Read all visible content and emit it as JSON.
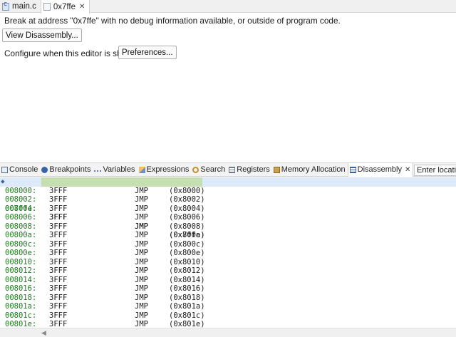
{
  "editor_tabs": [
    {
      "label": "main.c",
      "icon": "c-file-icon"
    },
    {
      "label": "0x7ffe",
      "icon": "disassembly-editor-icon",
      "active": true
    }
  ],
  "editor": {
    "message": "Break at address \"0x7ffe\" with no debug information available, or outside of program code.",
    "view_disassembly_label": "View Disassembly...",
    "configure_label": "Configure when this editor is shown",
    "preferences_label": "Preferences..."
  },
  "view_tabs": [
    {
      "label": "Console",
      "icon": "console-icon"
    },
    {
      "label": "Breakpoints",
      "icon": "breakpoints-icon"
    },
    {
      "label": "Variables",
      "icon": "variables-icon"
    },
    {
      "label": "Expressions",
      "icon": "expressions-icon"
    },
    {
      "label": "Search",
      "icon": "search-icon"
    },
    {
      "label": "Registers",
      "icon": "registers-icon"
    },
    {
      "label": "Memory Allocation",
      "icon": "memory-icon"
    },
    {
      "label": "Disassembly",
      "icon": "disassembly-icon",
      "active": true
    }
  ],
  "location_input": {
    "value": "Enter location"
  },
  "disassembly": {
    "rows": [
      {
        "addr": "007ffe:",
        "opcode": "3FFF",
        "mnemonic": "JMP",
        "arg": "(0x7ffe)",
        "current": true
      },
      {
        "addr": "008000:",
        "opcode": "3FFF",
        "mnemonic": "JMP",
        "arg": "(0x8000)"
      },
      {
        "addr": "008002:",
        "opcode": "3FFF",
        "mnemonic": "JMP",
        "arg": "(0x8002)"
      },
      {
        "addr": "008004:",
        "opcode": "3FFF",
        "mnemonic": "JMP",
        "arg": "(0x8004)"
      },
      {
        "addr": "008006:",
        "opcode": "3FFF",
        "mnemonic": "JMP",
        "arg": "(0x8006)"
      },
      {
        "addr": "008008:",
        "opcode": "3FFF",
        "mnemonic": "JMP",
        "arg": "(0x8008)"
      },
      {
        "addr": "00800a:",
        "opcode": "3FFF",
        "mnemonic": "JMP",
        "arg": "(0x800a)"
      },
      {
        "addr": "00800c:",
        "opcode": "3FFF",
        "mnemonic": "JMP",
        "arg": "(0x800c)"
      },
      {
        "addr": "00800e:",
        "opcode": "3FFF",
        "mnemonic": "JMP",
        "arg": "(0x800e)"
      },
      {
        "addr": "008010:",
        "opcode": "3FFF",
        "mnemonic": "JMP",
        "arg": "(0x8010)"
      },
      {
        "addr": "008012:",
        "opcode": "3FFF",
        "mnemonic": "JMP",
        "arg": "(0x8012)"
      },
      {
        "addr": "008014:",
        "opcode": "3FFF",
        "mnemonic": "JMP",
        "arg": "(0x8014)"
      },
      {
        "addr": "008016:",
        "opcode": "3FFF",
        "mnemonic": "JMP",
        "arg": "(0x8016)"
      },
      {
        "addr": "008018:",
        "opcode": "3FFF",
        "mnemonic": "JMP",
        "arg": "(0x8018)"
      },
      {
        "addr": "00801a:",
        "opcode": "3FFF",
        "mnemonic": "JMP",
        "arg": "(0x801a)"
      },
      {
        "addr": "00801c:",
        "opcode": "3FFF",
        "mnemonic": "JMP",
        "arg": "(0x801c)"
      },
      {
        "addr": "00801e:",
        "opcode": "3FFF",
        "mnemonic": "JMP",
        "arg": "(0x801e)"
      }
    ]
  }
}
